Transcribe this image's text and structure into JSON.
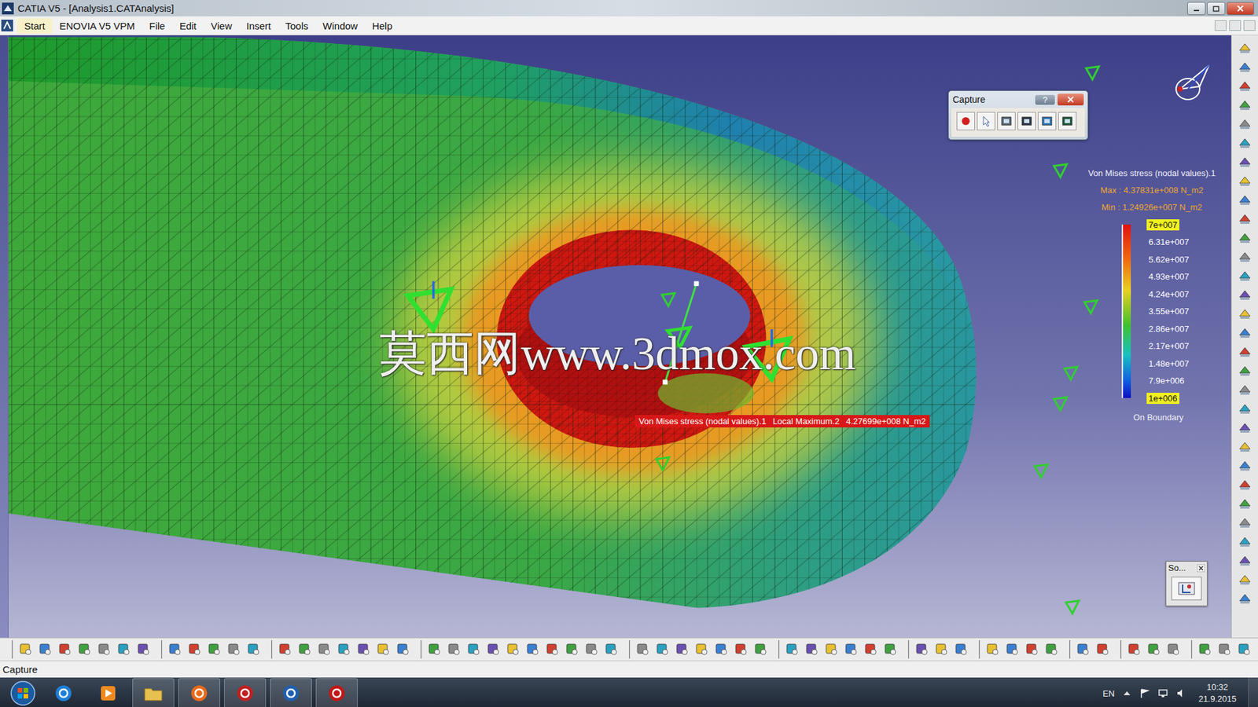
{
  "window": {
    "title": "CATIA V5 - [Analysis1.CATAnalysis]"
  },
  "menu": [
    "Start",
    "ENOVIA V5 VPM",
    "File",
    "Edit",
    "View",
    "Insert",
    "Tools",
    "Window",
    "Help"
  ],
  "capture_toolbar": {
    "title": "Capture",
    "help": "?"
  },
  "legend": {
    "title": "Von Mises stress (nodal values).1",
    "max": "Max : 4.37831e+008 N_m2",
    "min": "Min : 1.24926e+007 N_m2",
    "ticks": [
      {
        "label": "7e+007",
        "highlighted": true
      },
      {
        "label": "6.31e+007",
        "highlighted": false
      },
      {
        "label": "5.62e+007",
        "highlighted": false
      },
      {
        "label": "4.93e+007",
        "highlighted": false
      },
      {
        "label": "4.24e+007",
        "highlighted": false
      },
      {
        "label": "3.55e+007",
        "highlighted": false
      },
      {
        "label": "2.86e+007",
        "highlighted": false
      },
      {
        "label": "2.17e+007",
        "highlighted": false
      },
      {
        "label": "1.48e+007",
        "highlighted": false
      },
      {
        "label": "7.9e+006",
        "highlighted": false
      },
      {
        "label": "1e+006",
        "highlighted": true
      }
    ],
    "footer": "On Boundary"
  },
  "annotation": {
    "parts": [
      "Von Mises stress (nodal values).1",
      "Local Maximum.2",
      "4.27699e+008 N_m2"
    ]
  },
  "watermark": "莫西网www.3dmox.com",
  "mini_toolbar": {
    "title": "So..."
  },
  "status_bar": "Capture",
  "taskbar": {
    "language": "EN",
    "time": "10:32",
    "date": "21.9.2015"
  }
}
